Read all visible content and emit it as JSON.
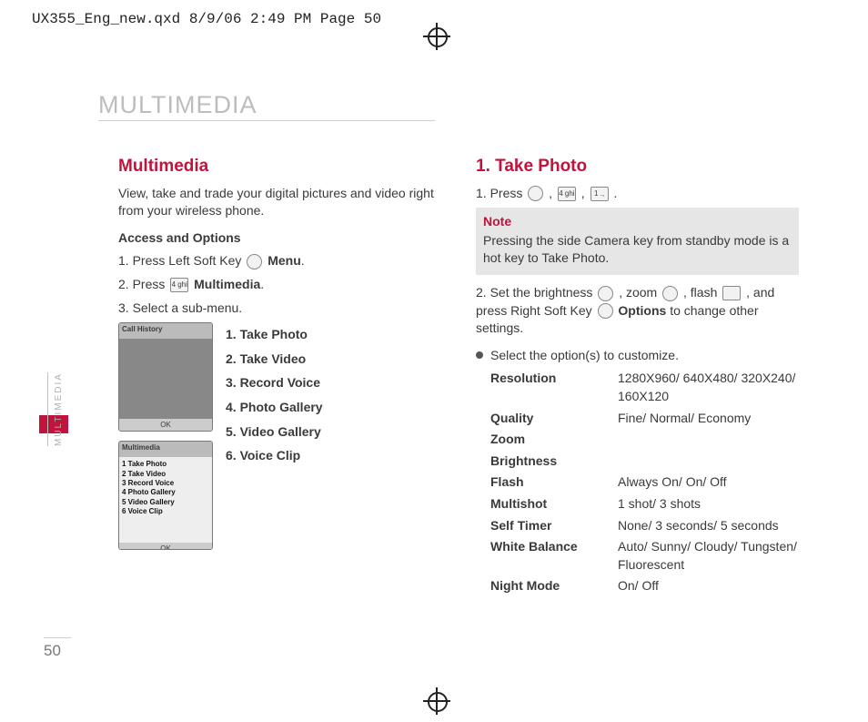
{
  "header": "UX355_Eng_new.qxd  8/9/06  2:49 PM  Page 50",
  "chapter_title": "MULTIMEDIA",
  "side_tab": "MULTIMEDIA",
  "page_number": "50",
  "left": {
    "section_title": "Multimedia",
    "intro": "View, take and trade your digital pictures and video right from your wireless phone.",
    "access_heading": "Access and Options",
    "step1_a": "1. Press Left Soft Key ",
    "step1_b": " Menu",
    "step2_a": "2. Press ",
    "step2_key": "4 ghi",
    "step2_b": " Multimedia",
    "step3": "3. Select a sub-menu.",
    "phone1_title": "Call History",
    "phone2_title": "Multimedia",
    "phone2_items": [
      "1 Take Photo",
      "2 Take Video",
      "3 Record Voice",
      "4 Photo Gallery",
      "5 Video Gallery",
      "6 Voice Clip"
    ],
    "phone_ok": "OK",
    "submenu": [
      "1. Take Photo",
      "2. Take Video",
      "3. Record Voice",
      "4. Photo Gallery",
      "5. Video Gallery",
      "6. Voice Clip"
    ]
  },
  "right": {
    "section_title": "1. Take Photo",
    "step1_a": "1. Press ",
    "key_4": "4 ghi",
    "key_1": "1 .,",
    "note_title": "Note",
    "note_body": "Pressing the side Camera key from standby mode is a hot key to Take Photo.",
    "step2_a": "2. Set the brightness ",
    "step2_b": " , zoom ",
    "step2_c": " , flash ",
    "step2_d": " , and press Right Soft Key ",
    "step2_opt": " Options",
    "step2_e": " to change other settings.",
    "bullet_text": "Select the option(s) to customize.",
    "options": [
      {
        "label": "Resolution",
        "value": "1280X960/ 640X480/ 320X240/ 160X120"
      },
      {
        "label": "Quality",
        "value": "Fine/ Normal/ Economy"
      },
      {
        "label": "Zoom",
        "value": ""
      },
      {
        "label": "Brightness",
        "value": ""
      },
      {
        "label": "Flash",
        "value": "Always On/ On/ Off"
      },
      {
        "label": "Multishot",
        "value": "1 shot/ 3 shots"
      },
      {
        "label": "Self Timer",
        "value": "None/ 3 seconds/ 5 seconds"
      },
      {
        "label": "White Balance",
        "value": "Auto/ Sunny/ Cloudy/ Tungsten/ Fluorescent"
      },
      {
        "label": "Night Mode",
        "value": "On/ Off"
      }
    ]
  }
}
